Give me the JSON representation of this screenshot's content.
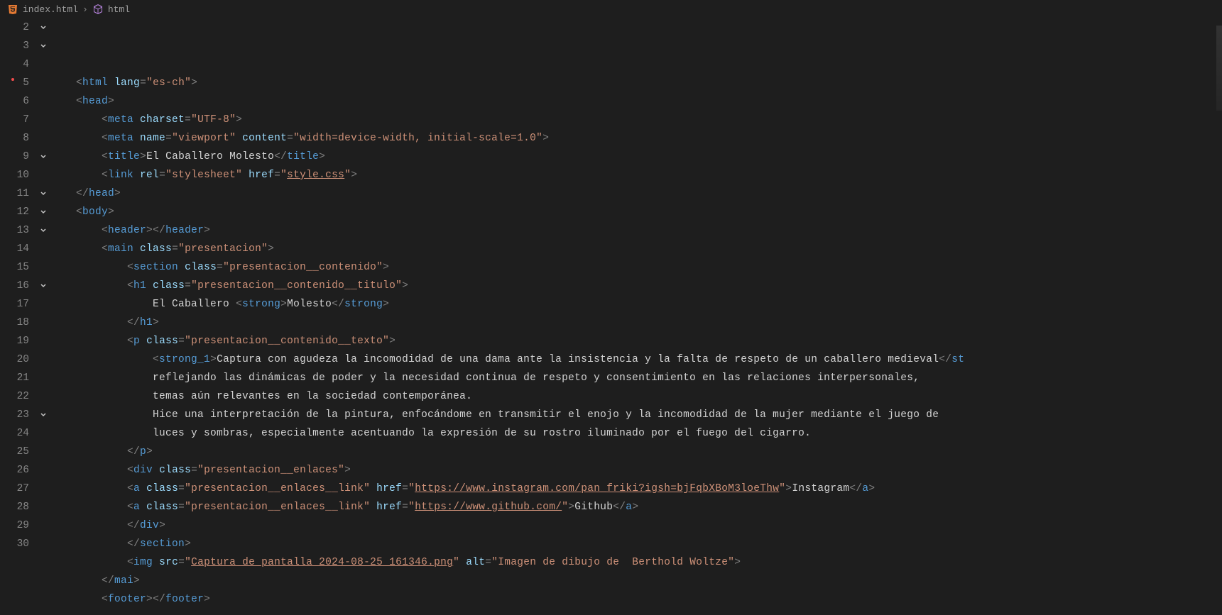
{
  "breadcrumb": {
    "file": "index.html",
    "symbol": "html"
  },
  "gutter": {
    "start": 2,
    "end": 30
  },
  "code": {
    "l2": {
      "tag_open": "<",
      "tag": "html",
      "attr": " lang",
      "eq": "=",
      "val": "\"es-ch\"",
      "close": ">"
    },
    "l3": {
      "tag_open": "<",
      "tag": "head",
      "close": ">"
    },
    "l4": {
      "tag_open": "<",
      "tag": "meta",
      "attr": " charset",
      "eq": "=",
      "val": "\"UTF-8\"",
      "close": ">"
    },
    "l5": {
      "tag_open": "<",
      "tag": "meta",
      "attr1": " name",
      "eq1": "=",
      "val1": "\"viewport\"",
      "attr2": " content",
      "eq2": "=",
      "val2": "\"width=device-width, initial-scale=1.0\"",
      "close": ">"
    },
    "l6": {
      "open": "<",
      "tag": "title",
      "gt": ">",
      "text": "El Caballero Molesto",
      "lt2": "</",
      "tag2": "title",
      "gt2": ">"
    },
    "l7": {
      "open": "<",
      "tag": "link",
      "attr1": " rel",
      "eq1": "=",
      "val1": "\"stylesheet\"",
      "attr2": " href",
      "eq2": "=",
      "val2": "\"",
      "val2link": "style.css",
      "val2q": "\"",
      "close": ">"
    },
    "l8": {
      "open": "</",
      "tag": "head",
      "close": ">"
    },
    "l9": {
      "open": "<",
      "tag": "body",
      "close": ">"
    },
    "l10": {
      "open": "<",
      "tag": "header",
      "gt": ">",
      "lt2": "</",
      "tag2": "header",
      "gt2": ">"
    },
    "l11": {
      "open": "<",
      "tag": "main",
      "attr": " class",
      "eq": "=",
      "val": "\"presentacion\"",
      "close": ">"
    },
    "l12": {
      "open": "<",
      "tag": "section",
      "attr": " class",
      "eq": "=",
      "val": "\"presentacion__contenido\"",
      "close": ">"
    },
    "l13": {
      "open": "<",
      "tag": "h1",
      "attr": " class",
      "eq": "=",
      "val": "\"presentacion__contenido__titulo\"",
      "close": ">"
    },
    "l14": {
      "text1": "El Caballero ",
      "open": "<",
      "tag": "strong",
      "gt": ">",
      "text2": "Molesto",
      "lt2": "</",
      "tag2": "strong",
      "gt2": ">"
    },
    "l15": {
      "open": "</",
      "tag": "h1",
      "close": ">"
    },
    "l16": {
      "open": "<",
      "tag": "p",
      "attr": " class",
      "eq": "=",
      "val": "\"presentacion__contenido__texto\"",
      "close": ">"
    },
    "l17": {
      "open": "<",
      "tag": "strong_1",
      "gt": ">",
      "text": "Captura con agudeza la incomodidad de una dama ante la insistencia y la falta de respeto de un caballero medieval",
      "lt2": "</",
      "tag2": "st"
    },
    "l18": {
      "text": "reflejando las dinámicas de poder y la necesidad continua de respeto y consentimiento en las relaciones interpersonales,"
    },
    "l19": {
      "text": "temas aún relevantes en la sociedad contemporánea."
    },
    "l20": {
      "text": "Hice una interpretación de la pintura, enfocándome en transmitir el enojo y la incomodidad de la mujer mediante el juego de"
    },
    "l21": {
      "text": "luces y sombras, especialmente acentuando la expresión de su rostro iluminado por el fuego del cigarro."
    },
    "l22": {
      "open": "</",
      "tag": "p",
      "close": ">"
    },
    "l23": {
      "open": "<",
      "tag": "div",
      "attr": " class",
      "eq": "=",
      "val": "\"presentacion__enlaces\"",
      "close": ">"
    },
    "l24": {
      "open": "<",
      "tag": "a",
      "attr1": " class",
      "eq1": "=",
      "val1": "\"presentacion__enlaces__link\"",
      "attr2": " href",
      "eq2": "=",
      "val2q1": "\"",
      "val2link": "https://www.instagram.com/pan_friki?igsh=bjFqbXBoM3loeThw",
      "val2q2": "\"",
      "gt": ">",
      "text": "Instagram",
      "lt2": "</",
      "tag2": "a",
      "gt2": ">"
    },
    "l25": {
      "open": "<",
      "tag": "a",
      "attr1": " class",
      "eq1": "=",
      "val1": "\"presentacion__enlaces__link\"",
      "attr2": " href",
      "eq2": "=",
      "val2q1": "\"",
      "val2link": "https://www.github.com/",
      "val2q2": "\"",
      "gt": ">",
      "text": "Github",
      "lt2": "</",
      "tag2": "a",
      "gt2": ">"
    },
    "l26": {
      "open": "</",
      "tag": "div",
      "close": ">"
    },
    "l27": {
      "open": "</",
      "tag": "section",
      "close": ">"
    },
    "l28": {
      "open": "<",
      "tag": "img",
      "attr1": " src",
      "eq1": "=",
      "val1q1": "\"",
      "val1link": "Captura de pantalla 2024-08-25 161346.png",
      "val1q2": "\"",
      "attr2": " alt",
      "eq2": "=",
      "val2": "\"Imagen de dibujo de  Berthold Woltze\"",
      "close": ">"
    },
    "l29": {
      "open": "</",
      "tag": "mai",
      "close": ">"
    },
    "l30": {
      "open": "<",
      "tag": "footer",
      "gt": ">",
      "lt2": "</",
      "tag2": "footer",
      "gt2": ">"
    }
  }
}
